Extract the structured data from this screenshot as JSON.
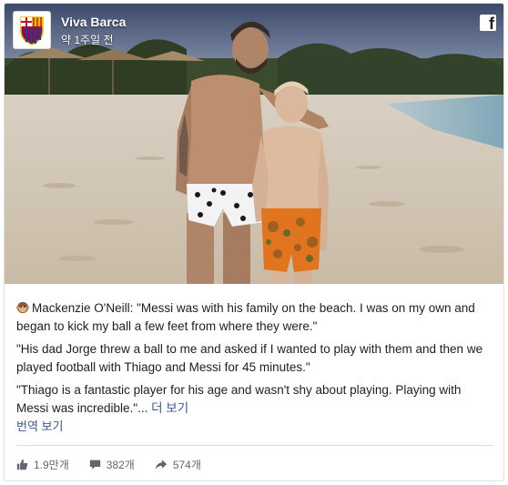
{
  "post": {
    "page_name": "Viva Barca",
    "timestamp": "약 1주일 전",
    "brand_icon": "facebook-f-icon",
    "paragraphs": [
      "Mackenzie O'Neill: \"Messi was with his family on the beach. I was on my own and began to kick my ball a few feet from where they were.\"",
      "\"His dad Jorge threw a ball to me and asked if I wanted to play with them and then we played football with Thiago and Messi for 45 minutes.\"",
      "\"Thiago is a fantastic player for his age and wasn't shy about playing. Playing with Messi was incredible.\"..."
    ],
    "see_more": "더 보기",
    "translate": "번역 보기"
  },
  "stats": {
    "likes": "1.9만개",
    "comments": "382개",
    "shares": "574개"
  },
  "colors": {
    "link": "#385898",
    "text": "#1c1e21",
    "muted": "#606770",
    "border": "#dddfe2"
  }
}
